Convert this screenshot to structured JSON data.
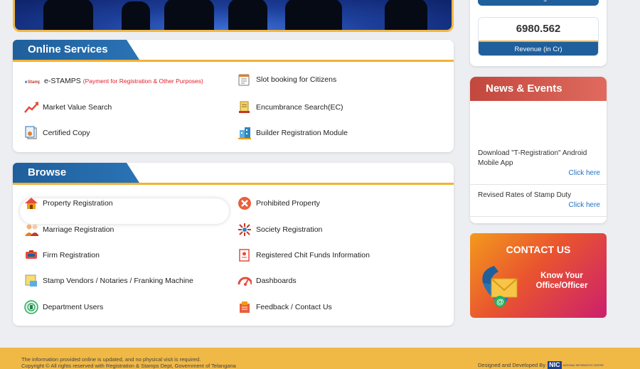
{
  "stats": {
    "top_label": "Document Registrations",
    "value": "6980.562",
    "label": "Revenue (in Cr)"
  },
  "online_services": {
    "title": "Online Services",
    "items": [
      {
        "label": "e-STAMPS",
        "note": "(Payment for Registration & Other Purposes)",
        "icon": "estamps-logo-icon"
      },
      {
        "label": "Slot booking for Citizens",
        "icon": "calendar-icon"
      },
      {
        "label": "Market Value Search",
        "icon": "trend-chart-icon"
      },
      {
        "label": "Encumbrance Search(EC)",
        "icon": "document-search-icon"
      },
      {
        "label": "Certified Copy",
        "icon": "certified-copy-icon"
      },
      {
        "label": "Builder Registration Module",
        "icon": "building-icon"
      }
    ]
  },
  "browse": {
    "title": "Browse",
    "items": [
      {
        "label": "Property Registration",
        "icon": "house-icon"
      },
      {
        "label": "Prohibited Property",
        "icon": "prohibited-icon"
      },
      {
        "label": "Marriage Registration",
        "icon": "couple-icon"
      },
      {
        "label": "Society Registration",
        "icon": "society-icon"
      },
      {
        "label": "Firm Registration",
        "icon": "firm-icon"
      },
      {
        "label": "Registered Chit Funds Information",
        "icon": "chit-funds-icon"
      },
      {
        "label": "Stamp Vendors / Notaries / Franking Machine",
        "icon": "stamp-vendor-icon"
      },
      {
        "label": "Dashboards",
        "icon": "dashboard-gauge-icon"
      },
      {
        "label": "Department Users",
        "icon": "department-emblem-icon"
      },
      {
        "label": "Feedback / Contact Us",
        "icon": "feedback-icon"
      }
    ]
  },
  "news": {
    "title": "News & Events",
    "items": [
      {
        "text": "Download \"T-Registration\" Android Mobile App",
        "link": "Click here"
      },
      {
        "text": "Revised Rates of Stamp Duty",
        "link": "Click here"
      }
    ]
  },
  "contact": {
    "title": "CONTACT US",
    "subtitle_line1": "Know Your",
    "subtitle_line2": "Office/Officer"
  },
  "footer": {
    "line1": "The information provided online is updated, and no physical visit is required.",
    "line2": "Copyright © All rights reserved with Registration & Stamps Dept, Government of Telangana",
    "designed_by": "Designed and Developed By",
    "nic": "NIC",
    "nic_full": "NATIONAL INFORMATICS CENTRE"
  },
  "colors": {
    "primary_blue": "#1f5f9c",
    "accent_yellow": "#f2b233",
    "news_red": "#c2483e",
    "link_blue": "#1f6fc4"
  }
}
